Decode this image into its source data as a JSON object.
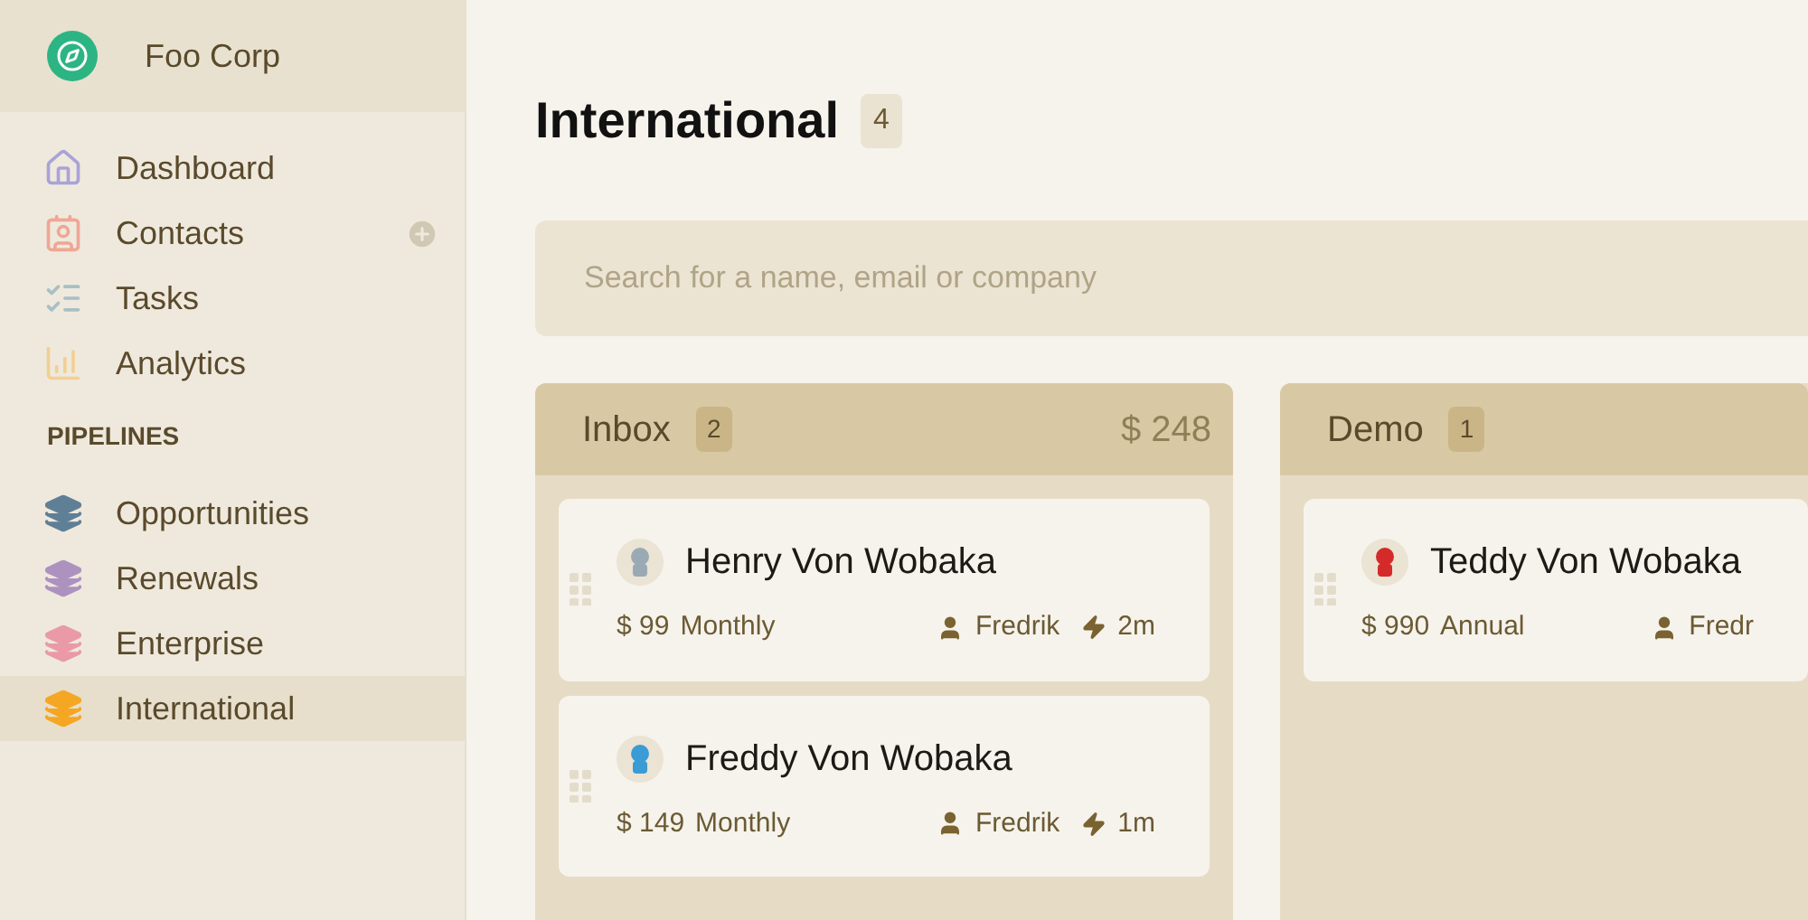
{
  "sidebar": {
    "company": "Foo Corp",
    "nav_items": [
      {
        "label": "Dashboard",
        "color": "#a9a3d8",
        "selected": false,
        "addable": false
      },
      {
        "label": "Contacts",
        "color": "#eea794",
        "selected": false,
        "addable": true
      },
      {
        "label": "Tasks",
        "color": "#a8bfc4",
        "selected": false,
        "addable": false
      },
      {
        "label": "Analytics",
        "color": "#f2cf95",
        "selected": false,
        "addable": false
      }
    ],
    "section_title": "PIPELINES",
    "pipelines": [
      {
        "label": "Opportunities",
        "color": "#5f7f96",
        "selected": false
      },
      {
        "label": "Renewals",
        "color": "#ad92c0",
        "selected": false
      },
      {
        "label": "Enterprise",
        "color": "#e99aa6",
        "selected": false
      },
      {
        "label": "International",
        "color": "#f5a623",
        "selected": true
      }
    ]
  },
  "page": {
    "title": "International",
    "count": "4"
  },
  "search": {
    "placeholder": "Search for a name, email or company"
  },
  "columns": [
    {
      "title": "Inbox",
      "count": "2",
      "total": "$ 248",
      "cards": [
        {
          "name": "Henry Von Wobaka",
          "color": "#9aaab5",
          "price": "$ 99",
          "plan": "Monthly",
          "owner": "Fredrik",
          "age": "2m"
        },
        {
          "name": "Freddy Von Wobaka",
          "color": "#3a9bd5",
          "price": "$ 149",
          "plan": "Monthly",
          "owner": "Fredrik",
          "age": "1m"
        }
      ]
    },
    {
      "title": "Demo",
      "count": "1",
      "cards": [
        {
          "name": "Teddy Von Wobaka",
          "color": "#d42a2a",
          "price": "$ 990",
          "plan": "Annual",
          "owner": "Fredr"
        }
      ]
    }
  ]
}
